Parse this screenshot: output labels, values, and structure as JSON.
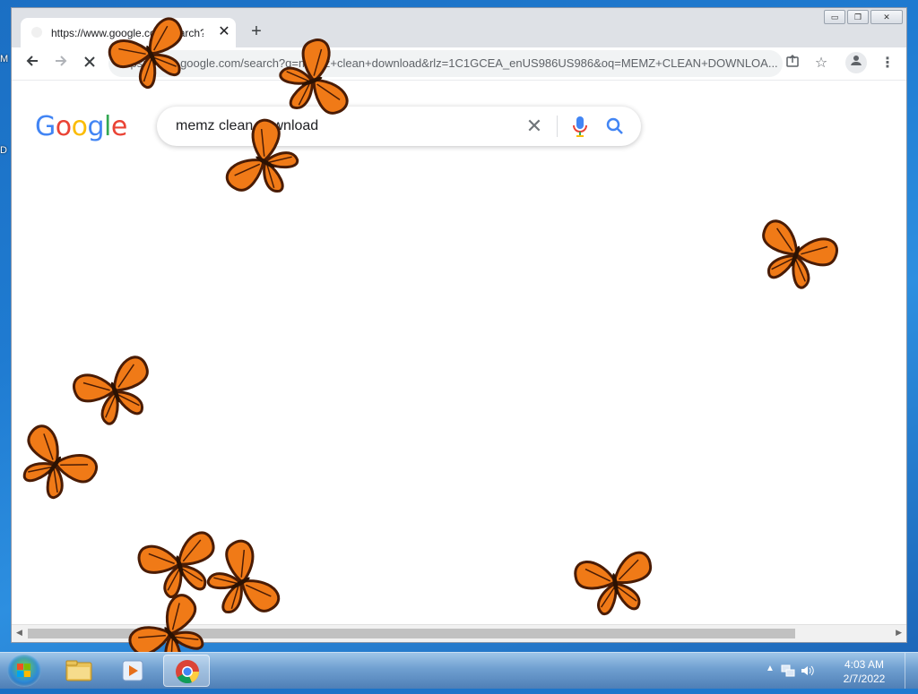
{
  "desktop": {
    "edge_letters": [
      "M",
      "D"
    ]
  },
  "browser": {
    "tab": {
      "title": "https://www.google.com/search?",
      "close_icon": "close-icon"
    },
    "new_tab": "+",
    "address": "https://www.google.com/search?q=memz+clean+download&rlz=1C1GCEA_enUS986US986&oq=MEMZ+CLEAN+DOWNLOA...",
    "window_buttons": {
      "minimize": "▭",
      "maximize": "❐",
      "close": "✕"
    }
  },
  "google": {
    "logo": [
      "G",
      "o",
      "o",
      "g",
      "l",
      "e"
    ],
    "logo_colors": [
      "#4285F4",
      "#EA4335",
      "#FBBC05",
      "#4285F4",
      "#34A853",
      "#EA4335"
    ],
    "query": "memz clean download"
  },
  "taskbar": {
    "time": "4:03 AM",
    "date": "2/7/2022",
    "apps": [
      "explorer",
      "media-player",
      "chrome"
    ]
  },
  "overlay": {
    "object": "monarch butterfly",
    "count": 10,
    "colors": {
      "wing": "#f07a17",
      "vein": "#4a1c05"
    }
  }
}
